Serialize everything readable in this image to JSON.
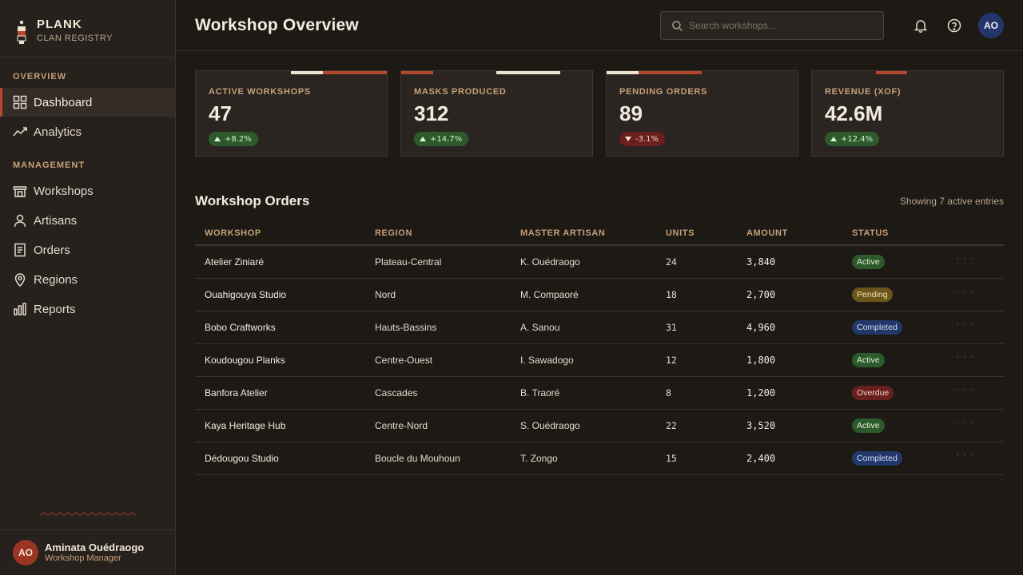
{
  "brand": {
    "name": "PLANK",
    "subtitle": "CLAN REGISTRY"
  },
  "sidebar": {
    "sections": [
      {
        "label": "OVERVIEW"
      },
      {
        "label": "MANAGEMENT"
      }
    ],
    "items": [
      {
        "label": "Dashboard",
        "icon": "grid-icon",
        "active": true
      },
      {
        "label": "Analytics",
        "icon": "trend-line-icon"
      },
      {
        "label": "Workshops",
        "icon": "workshop-icon"
      },
      {
        "label": "Artisans",
        "icon": "person-icon"
      },
      {
        "label": "Orders",
        "icon": "document-icon"
      },
      {
        "label": "Regions",
        "icon": "map-pin-icon"
      },
      {
        "label": "Reports",
        "icon": "bar-chart-icon"
      }
    ]
  },
  "user": {
    "initials": "AO",
    "name": "Aminata Ouédraogo",
    "role": "Workshop Manager"
  },
  "header": {
    "title": "Workshop Overview",
    "search_placeholder": "Search workshops...",
    "avatar_initials": "AO"
  },
  "stats": [
    {
      "label": "ACTIVE WORKSHOPS",
      "value": "47",
      "change": "+8.2%",
      "direction": "up"
    },
    {
      "label": "MASKS PRODUCED",
      "value": "312",
      "change": "+14.7%",
      "direction": "up"
    },
    {
      "label": "PENDING ORDERS",
      "value": "89",
      "change": "-3.1%",
      "direction": "down"
    },
    {
      "label": "REVENUE (XOF)",
      "value": "42.6M",
      "change": "+12.4%",
      "direction": "up"
    }
  ],
  "orders": {
    "title": "Workshop Orders",
    "meta": "Showing 7 active entries",
    "columns": [
      "WORKSHOP",
      "REGION",
      "MASTER ARTISAN",
      "UNITS",
      "AMOUNT",
      "STATUS"
    ],
    "rows": [
      {
        "workshop": "Atelier Ziniaré",
        "region": "Plateau-Central",
        "artisan": "K. Ouédraogo",
        "units": "24",
        "amount": "3,840",
        "status": "Active"
      },
      {
        "workshop": "Ouahigouya Studio",
        "region": "Nord",
        "artisan": "M. Compaoré",
        "units": "18",
        "amount": "2,700",
        "status": "Pending"
      },
      {
        "workshop": "Bobo Craftworks",
        "region": "Hauts-Bassins",
        "artisan": "A. Sanou",
        "units": "31",
        "amount": "4,960",
        "status": "Completed"
      },
      {
        "workshop": "Koudougou Planks",
        "region": "Centre-Ouest",
        "artisan": "I. Sawadogo",
        "units": "12",
        "amount": "1,800",
        "status": "Active"
      },
      {
        "workshop": "Banfora Atelier",
        "region": "Cascades",
        "artisan": "B. Traoré",
        "units": "8",
        "amount": "1,200",
        "status": "Overdue"
      },
      {
        "workshop": "Kaya Heritage Hub",
        "region": "Centre-Nord",
        "artisan": "S. Ouédraogo",
        "units": "22",
        "amount": "3,520",
        "status": "Active"
      },
      {
        "workshop": "Dédougou Studio",
        "region": "Boucle du Mouhoun",
        "artisan": "T. Zongo",
        "units": "15",
        "amount": "2,400",
        "status": "Completed"
      }
    ],
    "row_menu": "· · ·"
  },
  "colors": {
    "accent": "#b5472f",
    "background": "#1d1915",
    "sidebar": "#26211d",
    "label": "#c6a078",
    "status_active": "#2c5a2a",
    "status_pending": "#6b551b",
    "status_completed": "#22376a",
    "status_overdue": "#6a1f1c"
  }
}
